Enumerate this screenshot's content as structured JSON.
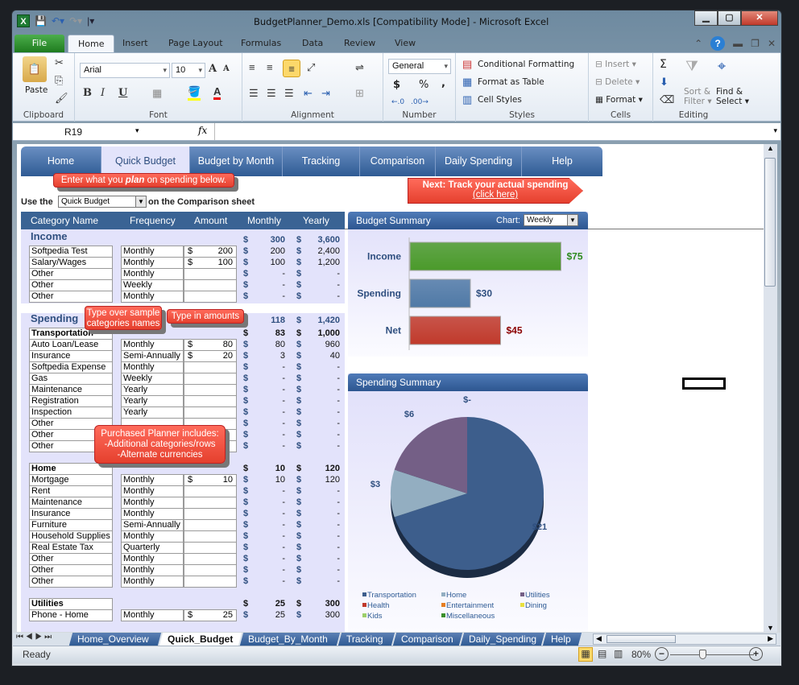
{
  "window": {
    "title": "BudgetPlanner_Demo.xls  [Compatibility Mode]  -  Microsoft Excel",
    "controls": [
      "minimize",
      "maximize",
      "close"
    ]
  },
  "ribbon": {
    "tabs": [
      "File",
      "Home",
      "Insert",
      "Page Layout",
      "Formulas",
      "Data",
      "Review",
      "View"
    ],
    "active_tab": "Home",
    "clipboard": {
      "label": "Clipboard",
      "paste": "Paste"
    },
    "font": {
      "label": "Font",
      "name": "Arial",
      "size": "10"
    },
    "alignment": {
      "label": "Alignment"
    },
    "number": {
      "label": "Number",
      "format": "General",
      "currency": "$",
      "percent": "%",
      "comma": ","
    },
    "styles": {
      "label": "Styles",
      "conditional": "Conditional Formatting",
      "table": "Format as Table",
      "cell_styles": "Cell Styles"
    },
    "cells": {
      "label": "Cells",
      "insert": "Insert",
      "delete": "Delete",
      "format": "Format"
    },
    "editing": {
      "label": "Editing",
      "sigma": "Σ",
      "sort1": "Sort &",
      "sort2": "Filter",
      "find1": "Find &",
      "find2": "Select"
    }
  },
  "formula_bar": {
    "name_box": "R19",
    "fx": "fx",
    "value": ""
  },
  "nav": {
    "items": [
      "Home",
      "Quick Budget",
      "Budget by Month",
      "Tracking",
      "Comparison",
      "Daily Spending",
      "Help"
    ],
    "active": "Quick Budget"
  },
  "callouts": {
    "plan_pre": "Enter what you ",
    "plan_em": "plan",
    "plan_post": " on spending below.",
    "next_title": "Next: Track your actual spending",
    "next_link": "(click here)",
    "type_over": "Type over sample categories names",
    "type_amounts": "Type in amounts",
    "purchased": [
      "Purchased Planner includes:",
      "-Additional categories/rows",
      "-Alternate currencies"
    ]
  },
  "use_the": {
    "prefix": "Use the",
    "select": "Quick Budget",
    "suffix": "on the Comparison sheet"
  },
  "columns": [
    "Category Name",
    "Frequency",
    "Amount",
    "Monthly",
    "Yearly"
  ],
  "income": {
    "title": "Income",
    "monthly": "300",
    "yearly": "3,600",
    "rows": [
      {
        "name": "Softpedia Test",
        "freq": "Monthly",
        "amount": "200",
        "monthly": "200",
        "yearly": "2,400"
      },
      {
        "name": "Salary/Wages",
        "freq": "Monthly",
        "amount": "100",
        "monthly": "100",
        "yearly": "1,200"
      },
      {
        "name": "Other",
        "freq": "Monthly",
        "amount": "",
        "monthly": "-",
        "yearly": "-"
      },
      {
        "name": "Other",
        "freq": "Weekly",
        "amount": "",
        "monthly": "-",
        "yearly": "-"
      },
      {
        "name": "Other",
        "freq": "Monthly",
        "amount": "",
        "monthly": "-",
        "yearly": "-"
      }
    ]
  },
  "spending": {
    "title": "Spending",
    "monthly": "118",
    "yearly": "1,420",
    "groups": [
      {
        "title": "Transportation",
        "monthly": "83",
        "yearly": "1,000",
        "rows": [
          {
            "name": "Auto Loan/Lease",
            "freq": "Monthly",
            "amount": "80",
            "monthly": "80",
            "yearly": "960"
          },
          {
            "name": "Insurance",
            "freq": "Semi-Annually",
            "amount": "20",
            "monthly": "3",
            "yearly": "40"
          },
          {
            "name": "Softpedia Expense",
            "freq": "Monthly",
            "amount": "",
            "monthly": "-",
            "yearly": "-"
          },
          {
            "name": "Gas",
            "freq": "Weekly",
            "amount": "",
            "monthly": "-",
            "yearly": "-"
          },
          {
            "name": "Maintenance",
            "freq": "Yearly",
            "amount": "",
            "monthly": "-",
            "yearly": "-"
          },
          {
            "name": "Registration",
            "freq": "Yearly",
            "amount": "",
            "monthly": "-",
            "yearly": "-"
          },
          {
            "name": "Inspection",
            "freq": "Yearly",
            "amount": "",
            "monthly": "-",
            "yearly": "-"
          },
          {
            "name": "Other",
            "freq": "",
            "amount": "",
            "monthly": "-",
            "yearly": "-"
          },
          {
            "name": "Other",
            "freq": "",
            "amount": "",
            "monthly": "-",
            "yearly": "-"
          },
          {
            "name": "Other",
            "freq": "",
            "amount": "",
            "monthly": "-",
            "yearly": "-"
          }
        ]
      },
      {
        "title": "Home",
        "monthly": "10",
        "yearly": "120",
        "rows": [
          {
            "name": "Mortgage",
            "freq": "Monthly",
            "amount": "10",
            "monthly": "10",
            "yearly": "120"
          },
          {
            "name": "Rent",
            "freq": "Monthly",
            "amount": "",
            "monthly": "-",
            "yearly": "-"
          },
          {
            "name": "Maintenance",
            "freq": "Monthly",
            "amount": "",
            "monthly": "-",
            "yearly": "-"
          },
          {
            "name": "Insurance",
            "freq": "Monthly",
            "amount": "",
            "monthly": "-",
            "yearly": "-"
          },
          {
            "name": "Furniture",
            "freq": "Semi-Annually",
            "amount": "",
            "monthly": "-",
            "yearly": "-"
          },
          {
            "name": "Household Supplies",
            "freq": "Monthly",
            "amount": "",
            "monthly": "-",
            "yearly": "-"
          },
          {
            "name": "Real Estate Tax",
            "freq": "Quarterly",
            "amount": "",
            "monthly": "-",
            "yearly": "-"
          },
          {
            "name": "Other",
            "freq": "Monthly",
            "amount": "",
            "monthly": "-",
            "yearly": "-"
          },
          {
            "name": "Other",
            "freq": "Monthly",
            "amount": "",
            "monthly": "-",
            "yearly": "-"
          },
          {
            "name": "Other",
            "freq": "Monthly",
            "amount": "",
            "monthly": "-",
            "yearly": "-"
          }
        ]
      },
      {
        "title": "Utilities",
        "monthly": "25",
        "yearly": "300",
        "rows": [
          {
            "name": "Phone - Home",
            "freq": "Monthly",
            "amount": "25",
            "monthly": "25",
            "yearly": "300"
          }
        ]
      }
    ]
  },
  "budget_summary": {
    "title": "Budget Summary",
    "chart_label": "Chart:",
    "chart_select": "Weekly"
  },
  "spending_summary": {
    "title": "Spending Summary"
  },
  "chart_data": [
    {
      "type": "bar",
      "title": "Budget Summary",
      "categories": [
        "Income",
        "Spending",
        "Net"
      ],
      "values": [
        75,
        30,
        45
      ],
      "labels": [
        "$75",
        "$30",
        "$45"
      ],
      "colors": [
        "#4a9a2a",
        "#4f79a6",
        "#c0392b"
      ],
      "label_colors": [
        "#2e8b1e",
        "#2f4f7f",
        "#8b0000"
      ],
      "orientation": "horizontal",
      "xlim": [
        0,
        80
      ]
    },
    {
      "type": "pie",
      "title": "Spending Summary",
      "categories": [
        "Transportation",
        "Home",
        "Utilities",
        "Health",
        "Entertainment",
        "Dining",
        "Kids",
        "Miscellaneous"
      ],
      "values": [
        21,
        3,
        6,
        0,
        0,
        0,
        0,
        0
      ],
      "labels": [
        "$21",
        "$3",
        "$6",
        "$-"
      ],
      "colors": [
        "#3d5e8c",
        "#93aec1",
        "#745f86",
        "#c0392b",
        "#e67e22",
        "#e8e040",
        "#9ccf6a",
        "#3a8f2a"
      ],
      "legend": "bottom"
    }
  ],
  "sheet_tabs": {
    "tabs": [
      "Home_Overview",
      "Quick_Budget",
      "Budget_By_Month",
      "Tracking",
      "Comparison",
      "Daily_Spending",
      "Help"
    ],
    "active": "Quick_Budget"
  },
  "status": {
    "text": "Ready",
    "zoom": "80%",
    "zoom_level": 0.8
  }
}
